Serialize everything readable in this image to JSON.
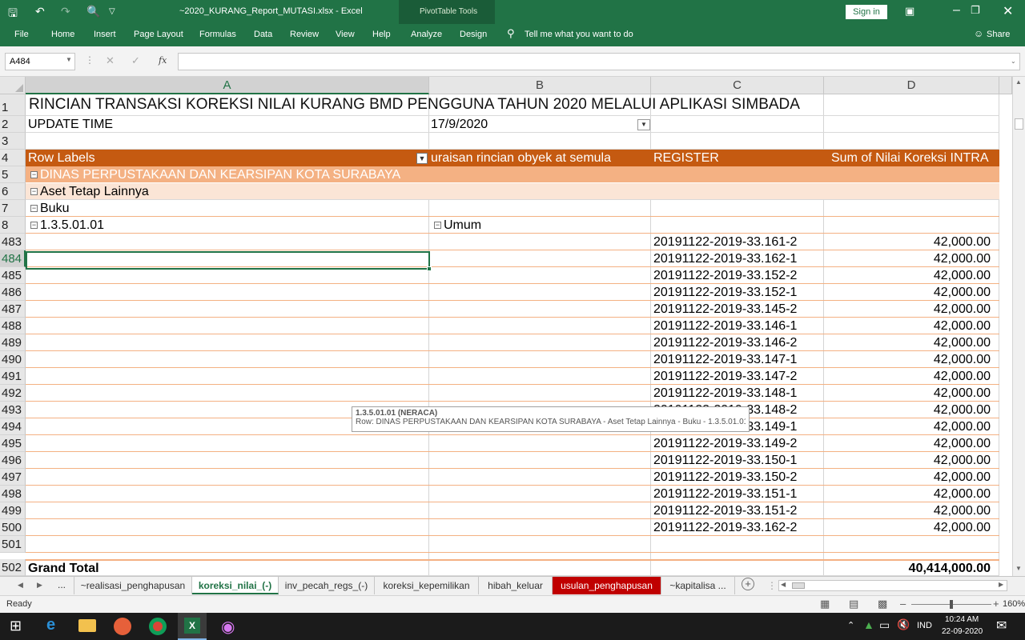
{
  "window": {
    "file_title": "~2020_KURANG_Report_MUTASI.xlsx - Excel",
    "context_tools": "PivotTable Tools",
    "sign_in": "Sign in"
  },
  "ribbon": {
    "tabs": [
      "File",
      "Home",
      "Insert",
      "Page Layout",
      "Formulas",
      "Data",
      "Review",
      "View",
      "Help",
      "Analyze",
      "Design"
    ],
    "tell_me": "Tell me what you want to do",
    "share": "Share"
  },
  "formula_bar": {
    "name_box": "A484",
    "fx_label": "fx",
    "content": ""
  },
  "columns": [
    "A",
    "B",
    "C",
    "D"
  ],
  "sheet": {
    "title": "RINCIAN TRANSAKSI KOREKSI NILAI KURANG BMD PENGGUNA TAHUN 2020 MELALUI APLIKASI SIMBADA",
    "update_label": "UPDATE TIME",
    "update_value": "17/9/2020",
    "pivot_headers": {
      "row_labels": "Row Labels",
      "col_b": "uraisan rincian obyek at semula",
      "col_c": "REGISTER",
      "col_d": "Sum of Nilai Koreksi INTRA"
    },
    "group_1": "DINAS PERPUSTAKAAN DAN KEARSIPAN KOTA SURABAYA",
    "group_2": "Aset Tetap Lainnya",
    "group_3": "Buku",
    "group_4": "1.3.5.01.01",
    "group_4_b": "Umum",
    "header_row_numbers": [
      "1",
      "2",
      "3",
      "4",
      "5",
      "6",
      "7",
      "8"
    ],
    "data_rows": [
      {
        "row": "483",
        "register": "20191122-2019-33.161-2",
        "value": "42,000.00"
      },
      {
        "row": "484",
        "register": "20191122-2019-33.162-1",
        "value": "42,000.00"
      },
      {
        "row": "485",
        "register": "20191122-2019-33.152-2",
        "value": "42,000.00"
      },
      {
        "row": "486",
        "register": "20191122-2019-33.152-1",
        "value": "42,000.00"
      },
      {
        "row": "487",
        "register": "20191122-2019-33.145-2",
        "value": "42,000.00"
      },
      {
        "row": "488",
        "register": "20191122-2019-33.146-1",
        "value": "42,000.00"
      },
      {
        "row": "489",
        "register": "20191122-2019-33.146-2",
        "value": "42,000.00"
      },
      {
        "row": "490",
        "register": "20191122-2019-33.147-1",
        "value": "42,000.00"
      },
      {
        "row": "491",
        "register": "20191122-2019-33.147-2",
        "value": "42,000.00"
      },
      {
        "row": "492",
        "register": "20191122-2019-33.148-1",
        "value": "42,000.00"
      },
      {
        "row": "493",
        "register": "20191122-2019-33.148-2",
        "value": "42,000.00"
      },
      {
        "row": "494",
        "register": "20191122-2019-33.149-1",
        "value": "42,000.00"
      },
      {
        "row": "495",
        "register": "20191122-2019-33.149-2",
        "value": "42,000.00"
      },
      {
        "row": "496",
        "register": "20191122-2019-33.150-1",
        "value": "42,000.00"
      },
      {
        "row": "497",
        "register": "20191122-2019-33.150-2",
        "value": "42,000.00"
      },
      {
        "row": "498",
        "register": "20191122-2019-33.151-1",
        "value": "42,000.00"
      },
      {
        "row": "499",
        "register": "20191122-2019-33.151-2",
        "value": "42,000.00"
      },
      {
        "row": "500",
        "register": "20191122-2019-33.162-2",
        "value": "42,000.00"
      },
      {
        "row": "501",
        "register": "",
        "value": ""
      }
    ],
    "grand_total_row": "502",
    "grand_total_label": "Grand Total",
    "grand_total_value": "40,414,000.00"
  },
  "tooltip": {
    "title": "1.3.5.01.01 (NERACA)",
    "detail": "Row: DINAS PERPUSTAKAAN DAN KEARSIPAN KOTA SURABAYA - Aset Tetap Lainnya - Buku - 1.3.5.01.01"
  },
  "sheet_tabs": {
    "ellipsis": "...",
    "tabs": [
      "~realisasi_penghapusan",
      "koreksi_nilai_(-)",
      "inv_pecah_regs_(-)",
      "koreksi_kepemilikan",
      "hibah_keluar",
      "usulan_penghapusan",
      "~kapitalisa ..."
    ],
    "active_index": 1,
    "red_index": 5
  },
  "status": {
    "ready": "Ready",
    "zoom": "160%"
  },
  "taskbar": {
    "lang": "IND",
    "time": "10:24 AM",
    "date": "22-09-2020"
  },
  "colors": {
    "excel_green": "#217346",
    "pivot_header": "#c55a11",
    "pivot_light": "#fbe5d6",
    "pivot_mid": "#f8cbad",
    "red_tab": "#c00000"
  }
}
